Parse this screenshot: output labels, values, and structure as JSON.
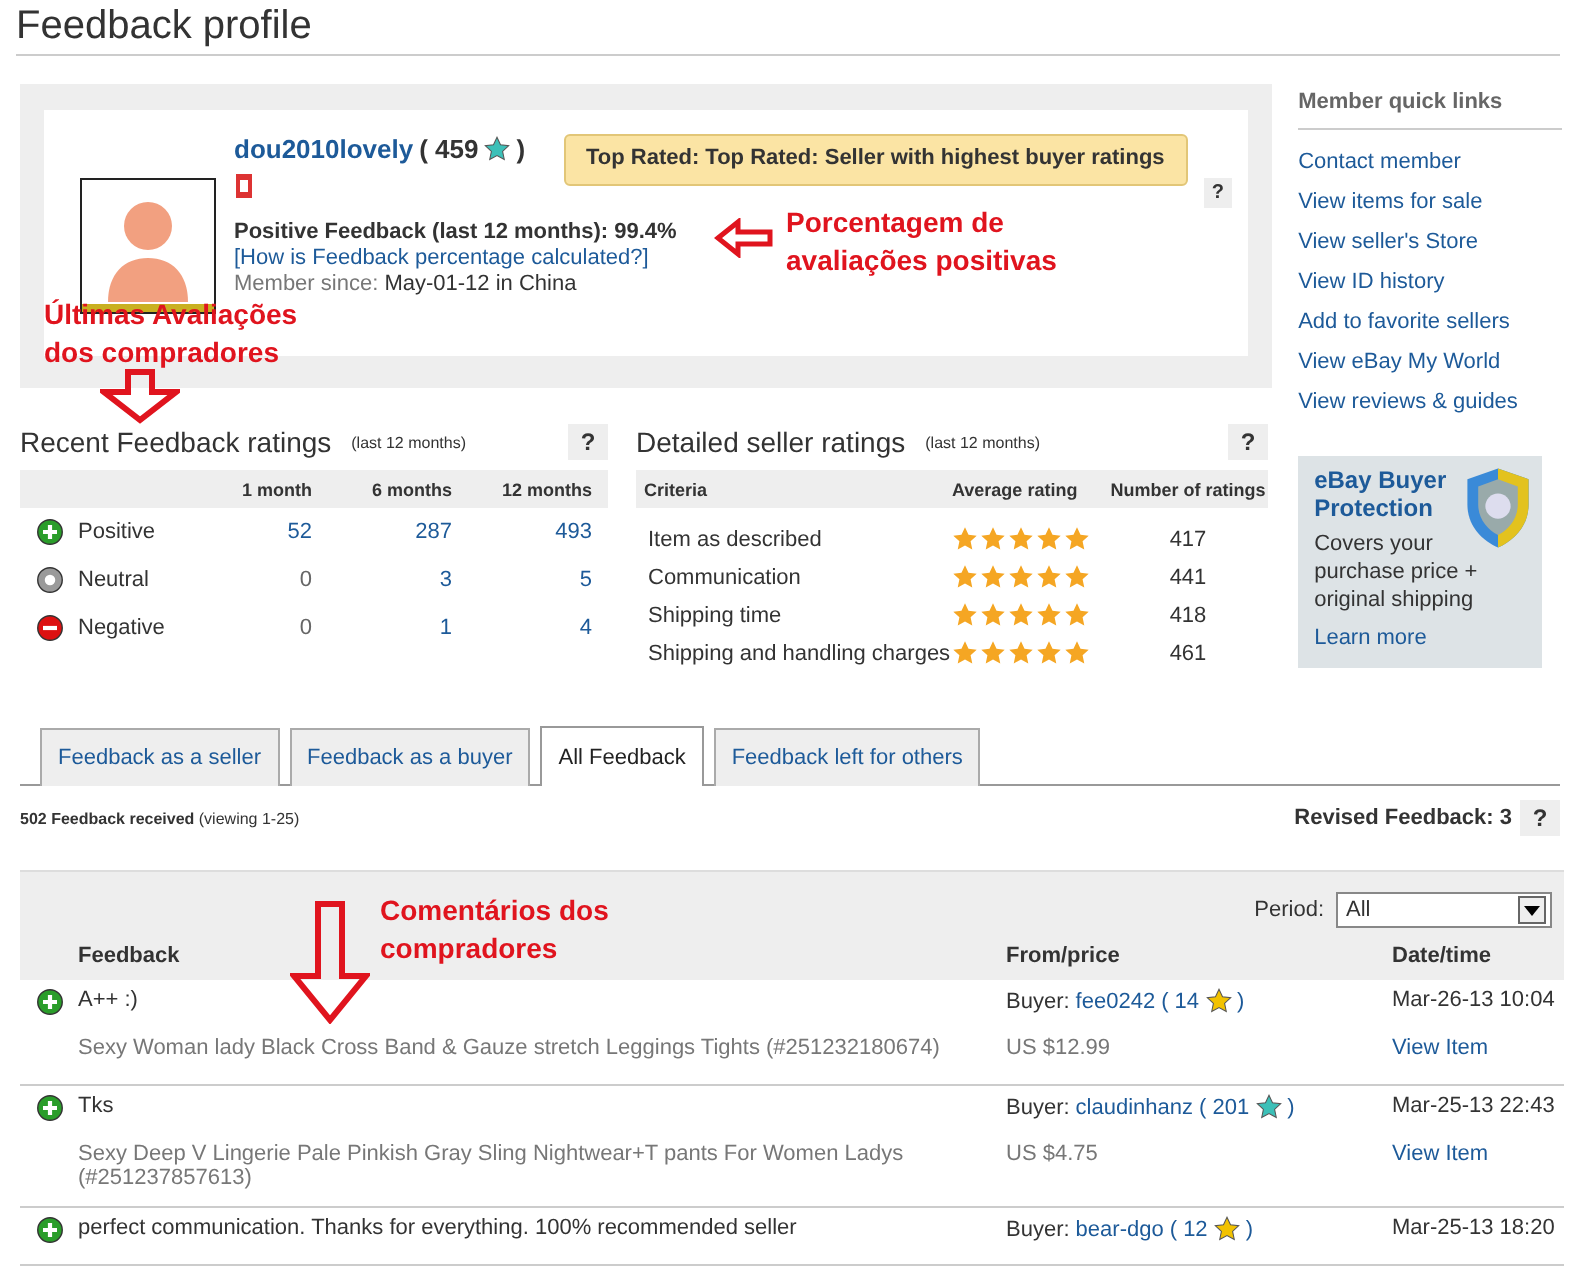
{
  "page_title": "Feedback profile",
  "profile": {
    "username": "dou2010lovely",
    "score_open": "( 459",
    "score_close": ")",
    "color": "#3cc0b8",
    "top_rated": "Top Rated: Top Rated: Seller with highest buyer ratings",
    "help": "?",
    "positive": "Positive Feedback (last 12 months): 99.4%",
    "percentage_link": "[How is Feedback percentage calculated?]",
    "member_since_label": "Member since:",
    "member_since": "May-01-12 in China"
  },
  "recent_ratings": {
    "title": "Recent Feedback ratings",
    "subtitle": "(last 12 months)",
    "help": "?",
    "columns": [
      "1 month",
      "6 months",
      "12 months"
    ],
    "rows": [
      {
        "kind": "positive",
        "label": "Positive",
        "values": [
          {
            "text": "52",
            "link": true
          },
          {
            "text": "287",
            "link": true
          },
          {
            "text": "493",
            "link": true
          }
        ]
      },
      {
        "kind": "neutral",
        "label": "Neutral",
        "values": [
          {
            "text": "0",
            "link": false
          },
          {
            "text": "3",
            "link": true
          },
          {
            "text": "5",
            "link": true
          }
        ]
      },
      {
        "kind": "negative",
        "label": "Negative",
        "values": [
          {
            "text": "0",
            "link": false
          },
          {
            "text": "1",
            "link": true
          },
          {
            "text": "4",
            "link": true
          }
        ]
      }
    ]
  },
  "detailed_ratings": {
    "title": "Detailed seller ratings",
    "subtitle": "(last 12 months)",
    "help": "?",
    "columns": [
      "Criteria",
      "Average rating",
      "Number of ratings"
    ],
    "rows": [
      {
        "label": "Item as described",
        "stars": 5,
        "count": "417"
      },
      {
        "label": "Communication",
        "stars": 5,
        "count": "441"
      },
      {
        "label": "Shipping time",
        "stars": 5,
        "count": "418"
      },
      {
        "label": "Shipping and handling charges",
        "stars": 5,
        "count": "461"
      }
    ]
  },
  "quick_links": {
    "title": "Member quick links",
    "links": [
      "Contact member",
      "View items for sale",
      "View seller's Store",
      "View ID history",
      "Add to favorite sellers",
      "View eBay My World",
      "View reviews & guides"
    ]
  },
  "protection": {
    "title": "eBay Buyer Protection",
    "text": "Covers your purchase price + original shipping",
    "link": "Learn more"
  },
  "tabs": [
    {
      "label": "Feedback as a seller",
      "selected": false
    },
    {
      "label": "Feedback as a buyer",
      "selected": false
    },
    {
      "label": "All Feedback",
      "selected": true
    },
    {
      "label": "Feedback left for others",
      "selected": false
    }
  ],
  "summary": {
    "received": "**502 Feedback received** (viewing 1-25)",
    "revised": "Revised Feedback: 3",
    "help": "?"
  },
  "period": {
    "label": "Period:",
    "value": "All"
  },
  "columns": [
    "Feedback",
    "From/price",
    "Date/time"
  ],
  "entries": [
    {
      "kind": "positive",
      "comment": "A++ :)",
      "item": "Sexy Woman lady Black Cross Band & Gauze stretch Leggings Tights (#251232180674)",
      "buyer_label": "Buyer:",
      "buyer": "fee0242",
      "score_open": "( 14",
      "score_close": ")",
      "color": "#f2c200",
      "price": "US $12.99",
      "date": "Mar-26-13 10:04",
      "view": "View Item"
    },
    {
      "kind": "positive",
      "comment": "Tks",
      "item": "Sexy Deep V Lingerie Pale Pinkish Gray Sling Nightwear+T pants For Women Ladys (#251237857613)",
      "buyer_label": "Buyer:",
      "buyer": "claudinhanz",
      "score_open": "( 201",
      "score_close": ")",
      "color": "#3cc0b8",
      "price": "US $4.75",
      "date": "Mar-25-13 22:43",
      "view": "View Item"
    },
    {
      "kind": "positive",
      "comment": "perfect communication. Thanks for everything. 100% recommended seller",
      "buyer_label": "Buyer:",
      "buyer": "bear-dgo",
      "score_open": "( 12",
      "score_close": ")",
      "color": "#f2c200",
      "date": "Mar-25-13 18:20"
    }
  ],
  "annotations": [
    {
      "kind": "left",
      "text": "Porcentagem de avaliações positivas"
    },
    {
      "kind": "down",
      "text": "Últimas Avaliações dos compradores"
    },
    {
      "kind": "down",
      "text": "Comentários dos compradores"
    }
  ]
}
